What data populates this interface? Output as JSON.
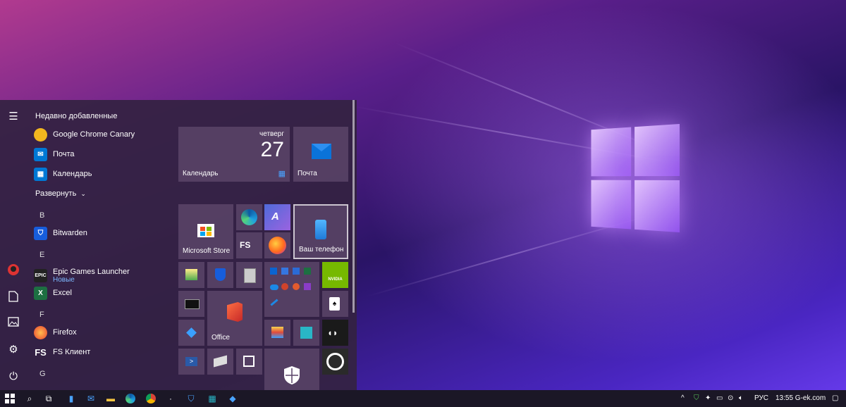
{
  "start_menu": {
    "recent_header": "Недавно добавленные",
    "recent_apps": [
      {
        "label": "Google Chrome Canary",
        "icon": "chrome-canary-icon"
      },
      {
        "label": "Почта",
        "icon": "mail-icon"
      },
      {
        "label": "Календарь",
        "icon": "calendar-icon"
      }
    ],
    "expand_label": "Развернуть",
    "sections": [
      {
        "letter": "B",
        "apps": [
          {
            "label": "Bitwarden",
            "icon": "bitwarden-icon"
          }
        ]
      },
      {
        "letter": "E",
        "apps": [
          {
            "label": "Epic Games Launcher",
            "sub": "Новые",
            "icon": "epic-games-icon"
          },
          {
            "label": "Excel",
            "icon": "excel-icon"
          }
        ]
      },
      {
        "letter": "F",
        "apps": [
          {
            "label": "Firefox",
            "icon": "firefox-icon"
          },
          {
            "label": "FS Клиент",
            "icon": "fs-client-icon"
          }
        ]
      },
      {
        "letter": "G",
        "apps": []
      }
    ],
    "tiles": {
      "calendar_day": "четверг",
      "calendar_date": "27",
      "calendar_label": "Календарь",
      "mail_label": "Почта",
      "store_label": "Microsoft Store",
      "phone_label": "Ваш телефон",
      "office_label": "Office",
      "fs_text": "FS",
      "nvidia_text": "NVIDIA"
    }
  },
  "taskbar": {
    "lang": "РУС",
    "clock": "13:55 G-ek.com"
  },
  "colors": {
    "accent": "#0078d4",
    "menu_bg": "#342242",
    "taskbar_bg": "#1b1726"
  }
}
